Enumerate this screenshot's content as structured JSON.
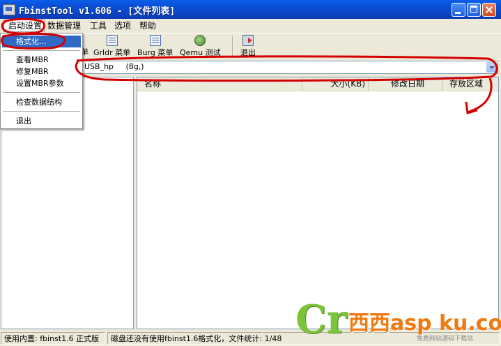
{
  "window": {
    "title": "FbinstTool v1.606 - [文件列表]"
  },
  "menubar": {
    "items": [
      "启动设置",
      "数据管理",
      "工具",
      "选项",
      "帮助"
    ]
  },
  "toolbar": {
    "partial_label": "单",
    "grldr_label": "Grldr 菜单",
    "burg_label": "Burg 菜单",
    "qemu_label": "Qemu 测试",
    "exit_label": "退出"
  },
  "disk": {
    "selected": "USB_hp     (8g,)"
  },
  "file_list": {
    "columns": [
      "名称",
      "大小(KB)",
      "修改日期",
      "存放区域"
    ]
  },
  "dropdown": {
    "format_label": "格式化...",
    "view_mbr": "查看MBR",
    "repair_mbr": "修复MBR",
    "set_mbr_params": "设置MBR参数",
    "check_structure": "检查数据结构",
    "exit": "退出"
  },
  "statusbar": {
    "left": "使用内置: fbinst1.6 正式版",
    "right": "磁盘还没有使用fbinst1.6格式化，文件统计: 1/48"
  },
  "watermark": {
    "glyph": "Cr",
    "main": "西西asp ku.com",
    "tagline": "免费网站源码下载站"
  },
  "colors": {
    "title_bar": "#0a4fd8",
    "selection": "#316ac5",
    "annotation": "#d40000",
    "face": "#ece9d8"
  }
}
